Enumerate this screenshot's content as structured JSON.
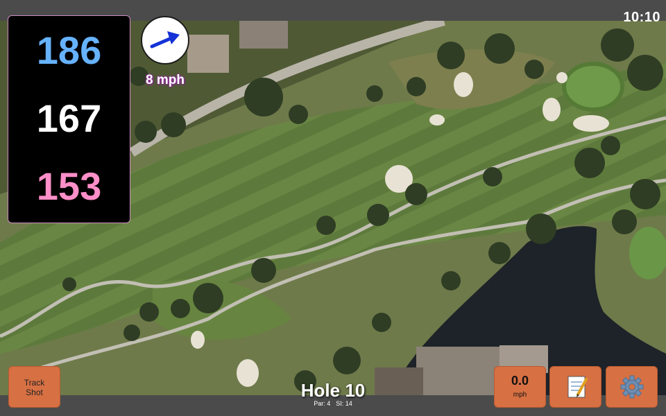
{
  "status": {
    "time": "10:10"
  },
  "distances": {
    "back": "186",
    "middle": "167",
    "front": "153"
  },
  "wind": {
    "speed_label": "8 mph",
    "direction_icon": "wind-arrow-icon"
  },
  "hole": {
    "title": "Hole 10",
    "par": "Par: 4",
    "si": "SI: 14"
  },
  "buttons": {
    "track_shot": "Track Shot",
    "wind_value": "0.0",
    "wind_unit": "mph",
    "notes_icon": "notepad-icon",
    "settings_icon": "gear-icon"
  },
  "colors": {
    "back_distance": "#66b2ff",
    "middle_distance": "#ffffff",
    "front_distance": "#ff8fc8",
    "button": "#d77043",
    "wind_text_glow": "#9b2fa6"
  }
}
